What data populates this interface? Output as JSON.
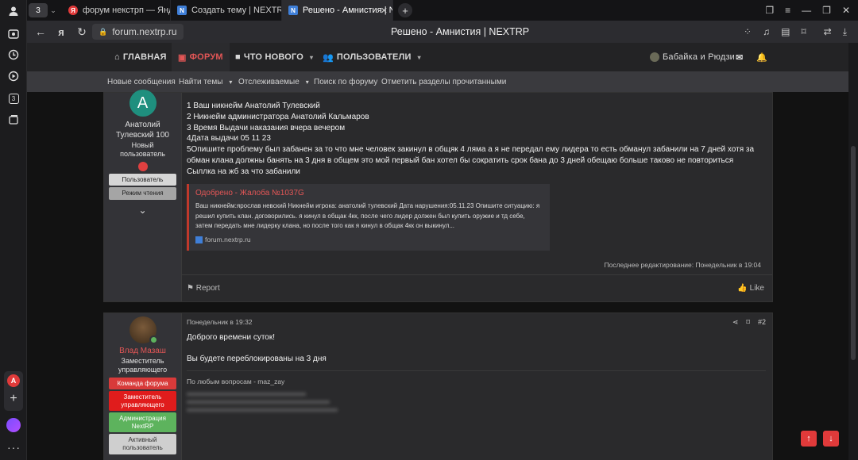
{
  "browser": {
    "tab_count": "3",
    "tabs": [
      {
        "title": "форум некстрп — Яндекс",
        "favicon_letter": "Я",
        "favicon_color": "#e03a3a"
      },
      {
        "title": "Создать тему | NEXTRP",
        "favicon_letter": "N",
        "favicon_color": "#3f7fd8"
      },
      {
        "title": "Решено - Амнистия | N",
        "favicon_letter": "N",
        "favicon_color": "#3f7fd8"
      }
    ],
    "url": "forum.nextrp.ru",
    "page_title": "Решено - Амнистия | NEXTRP"
  },
  "nav": {
    "home": "ГЛАВНАЯ",
    "forum": "ФОРУМ",
    "whats_new": "ЧТО НОВОГО",
    "users": "ПОЛЬЗОВАТЕЛИ",
    "account": "Бабайка и Рюдзи"
  },
  "subnav": [
    "Новые сообщения",
    "Найти темы",
    "Отслеживаемые",
    "Поиск по форуму",
    "Отметить разделы прочитанными"
  ],
  "post1": {
    "avatar_letter": "A",
    "username": "Анатолий Тулевский 100",
    "user_title": "Новый пользователь",
    "badges": [
      "Пользователь",
      "Режим чтения"
    ],
    "lines": [
      "1 Ваш никнейм Анатолий Тулевский",
      "2 Никнейм администратора Анатолий Кальмаров",
      "3 Время Выдачи наказания вчера вечером",
      "4Дата выдачи 05 11 23",
      "5Опишите проблему был забанен за то что мне человек закинул в общяк 4 ляма а я не передал ему лидера то есть обманул забанили на 7 дней хотя за обман клана должны банять на 3 дня в общем это мой первый бан хотел бы сократить срок бана до 3 дней обещаю больше таково не повториться",
      "Сыллка на жб за что забанили"
    ],
    "embed": {
      "title": "Одобрено - Жалоба №1037G",
      "text": "Ваш никнейм:ярослав невский Никнейм игрока: анатолий тулевский Дата нарушения:05.11.23 Опишите ситуацию: я решил купить клан. договорились. я кинул в общак 4кк, после чего лидер должен был купить оружие и тд себе, затем передать мне лидерку клана, но после того как я кинул в общак 4кк он выкинул...",
      "source": "forum.nextrp.ru"
    },
    "last_edit": "Последнее редактирование: Понедельник в 19:04",
    "report": "Report",
    "like": "Like"
  },
  "post2": {
    "username": "Влад Мазаш",
    "user_title": "Заместитель управляющего",
    "badges": [
      {
        "label": "Команда форума",
        "color": "#d83a3a"
      },
      {
        "label": "Заместитель управляющего",
        "color": "#e01c1c"
      },
      {
        "label": "Администрация NextRP",
        "color": "#5db35d"
      },
      {
        "label": "Активный пользователь",
        "color": "#cfcfcf"
      }
    ],
    "date": "Понедельник в 19:32",
    "number": "#2",
    "greeting": "Доброго времени суток!",
    "message": "Вы будете переблокированы на 3 дня",
    "signature": "По любым вопросам - maz_zay"
  },
  "colors": {
    "accent": "#e35656",
    "scroll_btn": "#e03a3a"
  }
}
